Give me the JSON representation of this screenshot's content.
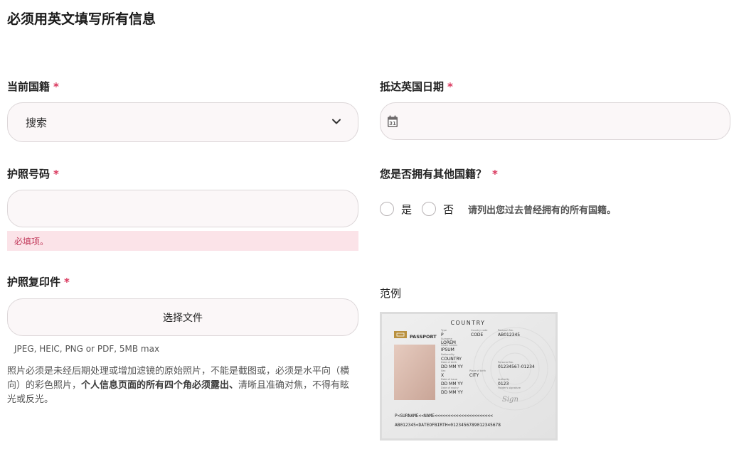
{
  "page": {
    "title": "必须用英文填写所有信息"
  },
  "nationality": {
    "label": "当前国籍",
    "required_mark": "*",
    "value": "搜索"
  },
  "arrival_date": {
    "label": "抵达英国日期",
    "required_mark": "*",
    "calendar_day": "31"
  },
  "passport_number": {
    "label": "护照号码",
    "required_mark": "*",
    "error": "必填项。"
  },
  "other_nationality": {
    "label": "您是否拥有其他国籍？",
    "required_mark": "*",
    "options": [
      "是",
      "否"
    ],
    "hint": "请列出您过去曾经拥有的所有国籍。"
  },
  "passport_copy": {
    "label": "护照复印件",
    "required_mark": "*",
    "button": "选择文件",
    "formats": "JPEG, HEIC, PNG or PDF, 5MB max",
    "note_part1": "照片必须是未经后期处理或增加滤镜的原始照片，不能是截图或，必须是水平向（横向）的彩色照片，",
    "note_bold": "个人信息页面的所有四个角必须露出、",
    "note_part2": "清晰且准确对焦，不得有眩光或反光。"
  },
  "example": {
    "label": "范例",
    "passport": {
      "country": "COUNTRY",
      "title": "PASSPORT",
      "type_label": "Type",
      "type": "P",
      "code_label": "Country code",
      "code": "CODE",
      "number_label": "Passport No.",
      "number": "AB012345",
      "surname_label": "Surname",
      "surname": "LOREM",
      "given_label": "Given names",
      "given": "IPSUM",
      "nationality_label": "Nationality",
      "nationality": "COUNTRY",
      "dob_label": "Date of birth",
      "dob": "DD MM YY",
      "personal_label": "Personal No.",
      "personal": "01234567-01234",
      "sex_label": "Sex",
      "sex": "X",
      "pob_label": "Place of birth",
      "pob": "CITY",
      "issue_label": "Date of issue",
      "issue": "DD MM YY",
      "authority_label": "Authority",
      "authority": "0123",
      "expiry_label": "Date of expiry",
      "expiry": "DD MM YY",
      "signature_label": "Holder's signature",
      "signature": "Sign",
      "mrz1": "P<SURNAME<<NAME<<<<<<<<<<<<<<<<<<<<<<",
      "mrz2": "AB012345<DATEOFBIRTH<0123456789012345678"
    }
  }
}
